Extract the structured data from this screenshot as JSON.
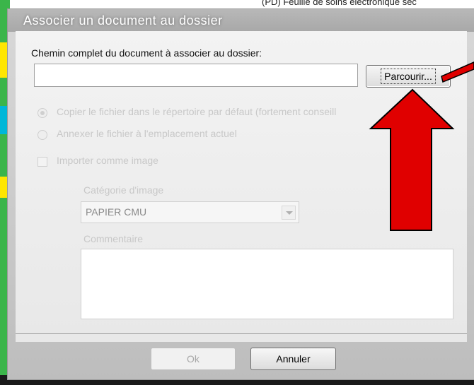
{
  "background": {
    "top_text": "(PD) Feuille de soins électronique séc"
  },
  "dialog": {
    "title": "Associer un document au dossier",
    "path_label": "Chemin complet du document à associer au dossier:",
    "path_value": "",
    "browse_label": "Parcourir...",
    "option_copy": "Copier le fichier dans le répertoire par défaut (fortement conseill",
    "option_attach": "Annexer le fichier à l'emplacement actuel",
    "import_image": "Importer comme image",
    "image_category_label": "Catégorie d'image",
    "image_category_value": "PAPIER CMU",
    "comment_label": "Commentaire",
    "comment_value": "",
    "ok_label": "Ok",
    "cancel_label": "Annuler"
  },
  "colors": {
    "annotation_arrow": "#e00000",
    "disabled_text": "#c8c8c8"
  },
  "icons": {
    "dropdown": "chevron-down-icon",
    "annotation": "red-arrow-up"
  }
}
